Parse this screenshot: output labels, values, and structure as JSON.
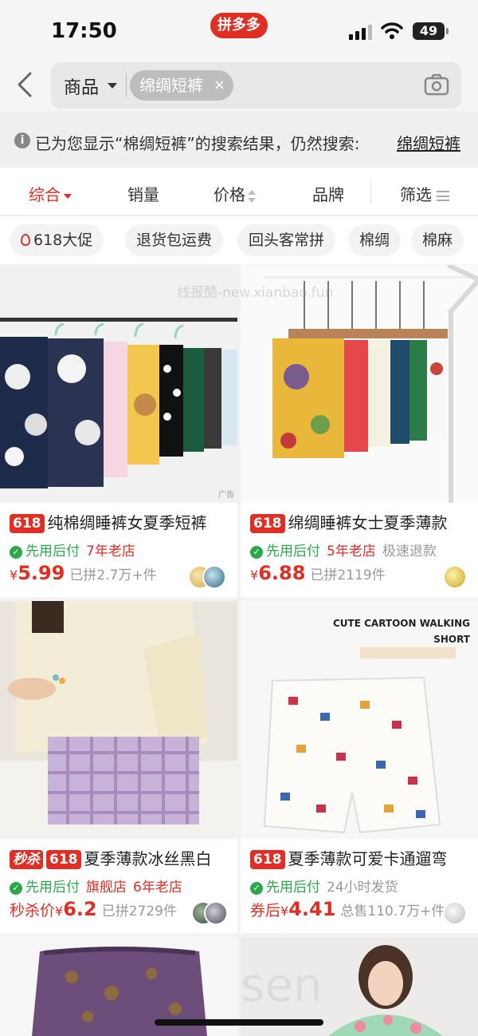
{
  "status_bar": {
    "time": "17:50",
    "app_badge": "拼多多",
    "battery": "49"
  },
  "search": {
    "scope_label": "商品",
    "query_chip": "绵绸短裤",
    "chip_clear": "×"
  },
  "notice": {
    "text": "已为您显示“棉绸短裤”的搜索结果，仍然搜索:",
    "link": "绵绸短裤"
  },
  "sort_bar": {
    "items": [
      "综合",
      "销量",
      "价格",
      "品牌",
      "筛选"
    ],
    "active": "综合"
  },
  "tags": [
    "618大促",
    "退货包运费",
    "回头客常拼",
    "棉绸",
    "棉麻"
  ],
  "watermark": "线报酷-new.xianbao.fun",
  "products": [
    {
      "badges": [
        "618"
      ],
      "title": "纯棉绸睡裤女夏季短裤",
      "guarantee": "先用后付",
      "store_tags": [
        "7年老店"
      ],
      "grey_tags": [],
      "price_prefix": "",
      "currency": "¥",
      "price": "5.99",
      "sold": "已拼2.7万+件",
      "ad_label": "广告"
    },
    {
      "badges": [
        "618"
      ],
      "title": "绵绸睡裤女士夏季薄款",
      "guarantee": "先用后付",
      "store_tags": [
        "5年老店"
      ],
      "grey_tags": [
        "极速退款"
      ],
      "price_prefix": "",
      "currency": "¥",
      "price": "6.88",
      "sold": "已拼2119件",
      "ad_label": ""
    },
    {
      "badges": [
        "秒杀",
        "618"
      ],
      "title": "夏季薄款冰丝黑白",
      "guarantee": "先用后付",
      "store_tags": [
        "旗舰店",
        "6年老店"
      ],
      "grey_tags": [],
      "price_prefix": "秒杀价",
      "currency": "¥",
      "price": "6.2",
      "sold": "已拼2729件",
      "ad_label": ""
    },
    {
      "badges": [
        "618"
      ],
      "title": "夏季薄款可爱卡通遛弯",
      "guarantee": "先用后付",
      "store_tags": [],
      "grey_tags": [
        "24小时发货"
      ],
      "price_prefix": "券后",
      "currency": "¥",
      "price": "4.41",
      "sold": "总售110.7万+件",
      "ad_label": "",
      "image_caption": [
        "CUTE CARTOON WALKING",
        "SHORT"
      ]
    }
  ],
  "colors": {
    "accent": "#e02e24",
    "guarantee_green": "#2aa84a"
  }
}
